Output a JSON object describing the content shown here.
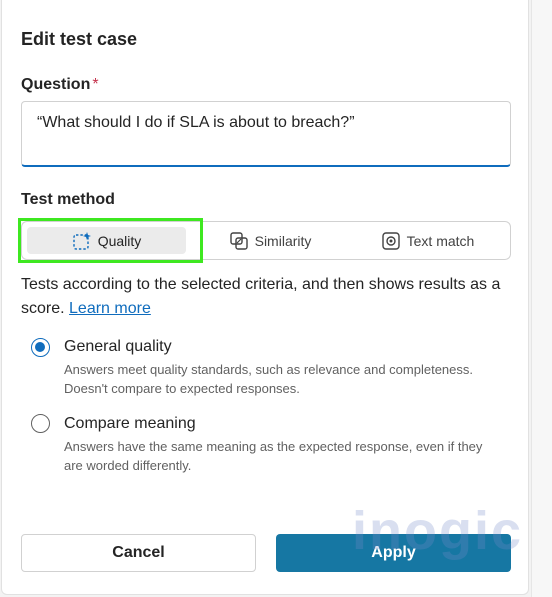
{
  "dialog": {
    "title": "Edit test case"
  },
  "question": {
    "label": "Question",
    "required_marker": "*",
    "value": "“What should I do if SLA is about to breach?”"
  },
  "test_method": {
    "label": "Test method",
    "options": [
      {
        "label": "Quality",
        "icon": "sparkle-dashed-icon",
        "active": true
      },
      {
        "label": "Similarity",
        "icon": "overlap-squares-icon",
        "active": false
      },
      {
        "label": "Text match",
        "icon": "target-icon",
        "active": false
      }
    ],
    "description": "Tests according to the selected criteria, and then shows results as a score.",
    "learn_more": "Learn more"
  },
  "criteria": [
    {
      "title": "General quality",
      "description": "Answers meet quality standards, such as relevance and completeness. Doesn't compare to expected responses.",
      "checked": true
    },
    {
      "title": "Compare meaning",
      "description": "Answers have the same meaning as the expected response, even if they are worded differently.",
      "checked": false
    }
  ],
  "buttons": {
    "cancel": "Cancel",
    "apply": "Apply"
  },
  "watermark": "inogic",
  "colors": {
    "accent": "#0f6cbd",
    "apply_button": "#1677a3",
    "highlight": "#3ee820",
    "required": "#c4314b"
  }
}
